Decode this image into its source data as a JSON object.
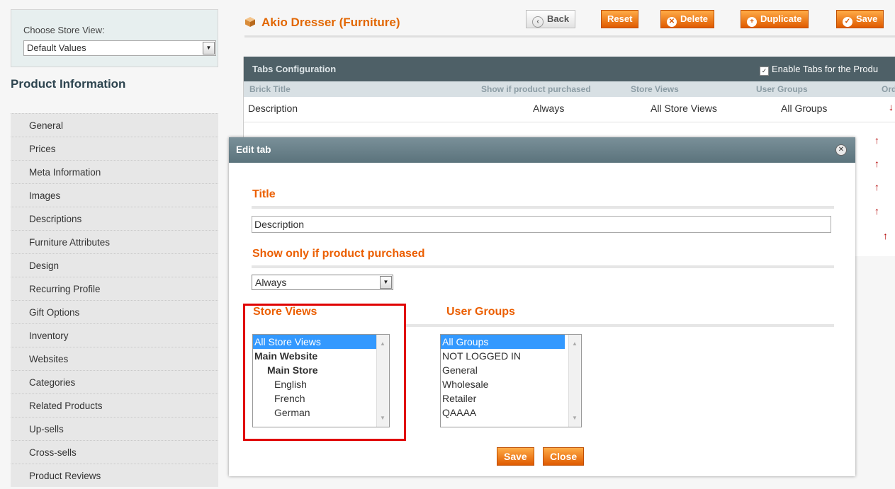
{
  "sidebar": {
    "store_label": "Choose Store View:",
    "store_value": "Default Values",
    "title": "Product Information",
    "items": [
      {
        "label": "General"
      },
      {
        "label": "Prices"
      },
      {
        "label": "Meta Information"
      },
      {
        "label": "Images"
      },
      {
        "label": "Descriptions"
      },
      {
        "label": "Furniture Attributes"
      },
      {
        "label": "Design"
      },
      {
        "label": "Recurring Profile"
      },
      {
        "label": "Gift Options"
      },
      {
        "label": "Inventory"
      },
      {
        "label": "Websites"
      },
      {
        "label": "Categories"
      },
      {
        "label": "Related Products"
      },
      {
        "label": "Up-sells"
      },
      {
        "label": "Cross-sells"
      },
      {
        "label": "Product Reviews"
      }
    ]
  },
  "header": {
    "title": "Akio Dresser (Furniture)",
    "back": "Back",
    "reset": "Reset",
    "delete": "Delete",
    "duplicate": "Duplicate",
    "save": "Save"
  },
  "tabs_config": {
    "title": "Tabs Configuration",
    "enable_label": "Enable Tabs for the Produ",
    "columns": [
      "Brick Title",
      "Show if product purchased",
      "Store Views",
      "User Groups",
      "Ord"
    ],
    "row": {
      "title": "Description",
      "purchased": "Always",
      "store_views": "All Store Views",
      "groups": "All Groups"
    }
  },
  "modal": {
    "title": "Edit tab",
    "title_label": "Title",
    "title_value": "Description",
    "purchased_label": "Show only if product purchased",
    "purchased_value": "Always",
    "store_views_label": "Store Views",
    "user_groups_label": "User Groups",
    "store_views": [
      "All Store Views",
      "Main Website",
      "Main Store",
      "English",
      "French",
      "German"
    ],
    "user_groups": [
      "All Groups",
      "NOT LOGGED IN",
      "General",
      "Wholesale",
      "Retailer",
      "QAAAA"
    ],
    "save": "Save",
    "close": "Close"
  },
  "colors": {
    "accent": "#eb5e00",
    "highlight": "#e00000",
    "header_bar": "#4e6067"
  }
}
